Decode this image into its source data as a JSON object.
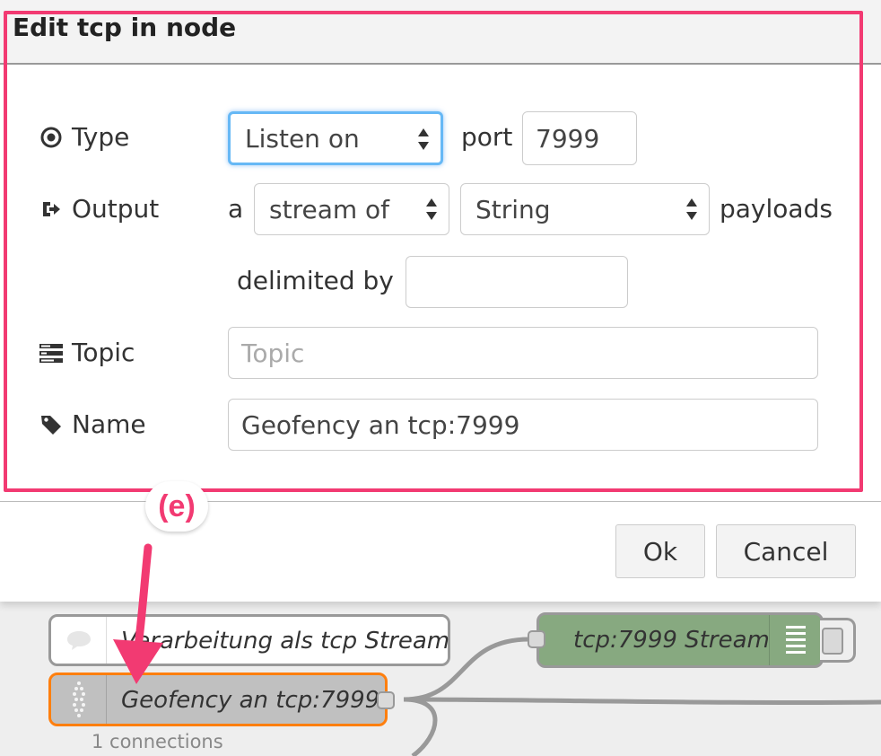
{
  "dialog": {
    "title": "Edit tcp in node",
    "ok_label": "Ok",
    "cancel_label": "Cancel"
  },
  "form": {
    "type_label": "Type",
    "type_value": "Listen on",
    "port_label": "port",
    "port_value": "7999",
    "output_label": "Output",
    "output_prefix": "a",
    "output_mode_value": "stream of",
    "output_type_value": "String",
    "output_suffix": "payloads",
    "delimited_label": "delimited by",
    "delimited_value": "",
    "topic_label": "Topic",
    "topic_placeholder": "Topic",
    "name_label": "Name",
    "name_value": "Geofency an tcp:7999"
  },
  "annotation": {
    "label": "(e)",
    "color": "#f23a72"
  },
  "flow": {
    "comment_node_label": "Verarbeitung als tcp Stream",
    "tcp_in_node_label": "Geofency an tcp:7999",
    "debug_node_label": "tcp:7999 Stream",
    "connections_text": "1 connections"
  },
  "colors": {
    "highlight": "#f23a72",
    "focus": "#66b8f5",
    "debug_node": "#87a980",
    "selected_outline": "#ff7f0e"
  }
}
